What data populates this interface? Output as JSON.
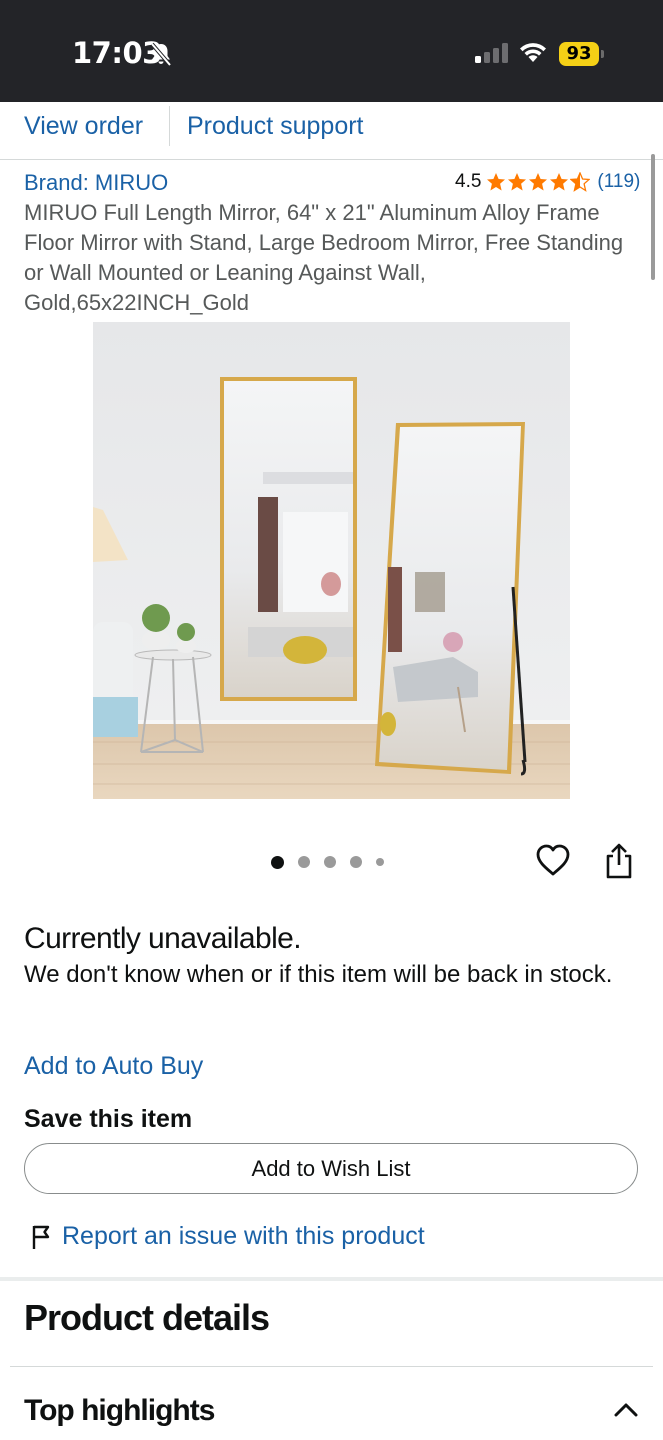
{
  "status_bar": {
    "time": "17:03",
    "battery": "93",
    "icons": [
      "bell-slash-icon",
      "signal-icon",
      "wifi-icon",
      "battery-icon"
    ],
    "battery_color": "#f5d016"
  },
  "tabs": [
    {
      "label": "View order"
    },
    {
      "label": "Product support"
    }
  ],
  "product": {
    "brand": "Brand: MIRUO",
    "rating": "4.5",
    "rating_stars": 4.5,
    "rating_count": "(119)",
    "title": "MIRUO Full Length Mirror, 64\" x 21\" Aluminum Alloy Frame Floor Mirror with Stand, Large Bedroom Mirror, Free Standing or Wall Mounted or Leaning Against Wall, Gold,65x22INCH_Gold",
    "image_count": 5,
    "image_active_index": 0
  },
  "availability": {
    "heading": "Currently unavailable.",
    "message": "We don't know when or if this item will be back in stock."
  },
  "actions": {
    "auto_buy": "Add to Auto Buy",
    "save_heading": "Save this item",
    "wishlist_button": "Add to Wish List",
    "report_link": "Report an issue with this product"
  },
  "details": {
    "heading": "Product details",
    "highlights": "Top highlights"
  },
  "colors": {
    "link": "#1a61a6",
    "star": "#ff7a00",
    "status_bar_bg": "#232428"
  }
}
